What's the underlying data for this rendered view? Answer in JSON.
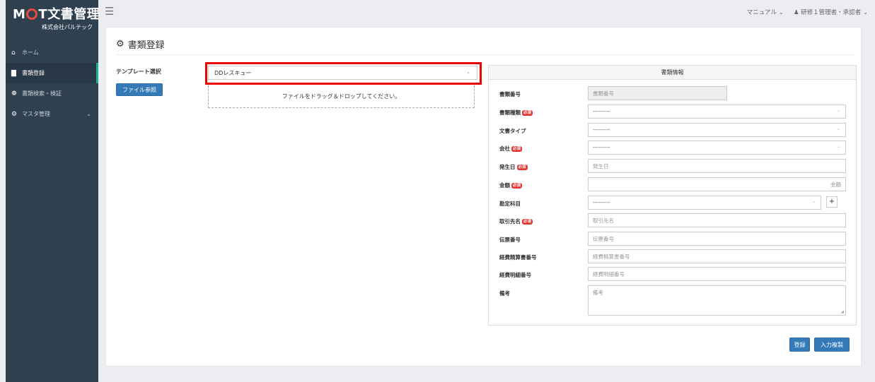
{
  "brand": {
    "title_pre": "M",
    "title_post": "T文書管理",
    "company": "株式会社パルテック"
  },
  "nav": {
    "items": [
      {
        "label": "ホーム",
        "icon": "home-icon",
        "glyph": "⌂"
      },
      {
        "label": "書類登録",
        "icon": "file-icon",
        "glyph": "▇"
      },
      {
        "label": "書類検索・検証",
        "icon": "users-icon",
        "glyph": "❁"
      },
      {
        "label": "マスタ管理",
        "icon": "gears-icon",
        "glyph": "⚙"
      }
    ]
  },
  "topbar": {
    "manual": "マニュアル ⌄",
    "user": "♟ 研修１管理者・承認者 ⌄"
  },
  "page": {
    "title": "書類登録"
  },
  "template": {
    "label": "テンプレート選択",
    "selected": "DDレスキュー",
    "file_button": "ファイル参照",
    "dropzone": "ファイルをドラッグ＆ドロップしてください。"
  },
  "info": {
    "heading": "書類情報",
    "required_badge": "必須",
    "fields": {
      "doc_no": {
        "label": "書類番号",
        "placeholder": "書類番号"
      },
      "doc_kind": {
        "label": "書類種類",
        "value": "---------"
      },
      "doc_type": {
        "label": "文書タイプ",
        "value": "---------"
      },
      "company": {
        "label": "会社",
        "value": "---------"
      },
      "date": {
        "label": "発生日",
        "placeholder": "発生日"
      },
      "amount": {
        "label": "金額",
        "placeholder": "金額"
      },
      "account": {
        "label": "勘定科目",
        "value": "---------"
      },
      "partner": {
        "label": "取引先名",
        "placeholder": "取引先名"
      },
      "slip": {
        "label": "伝票番号",
        "placeholder": "伝票番号"
      },
      "expense": {
        "label": "経費精算書番号",
        "placeholder": "経費精算書番号"
      },
      "expense_detail": {
        "label": "経費明細番号",
        "placeholder": "経費明細番号"
      },
      "note": {
        "label": "備考",
        "placeholder": "備考"
      }
    }
  },
  "actions": {
    "register": "登録",
    "clear": "入力複製"
  }
}
